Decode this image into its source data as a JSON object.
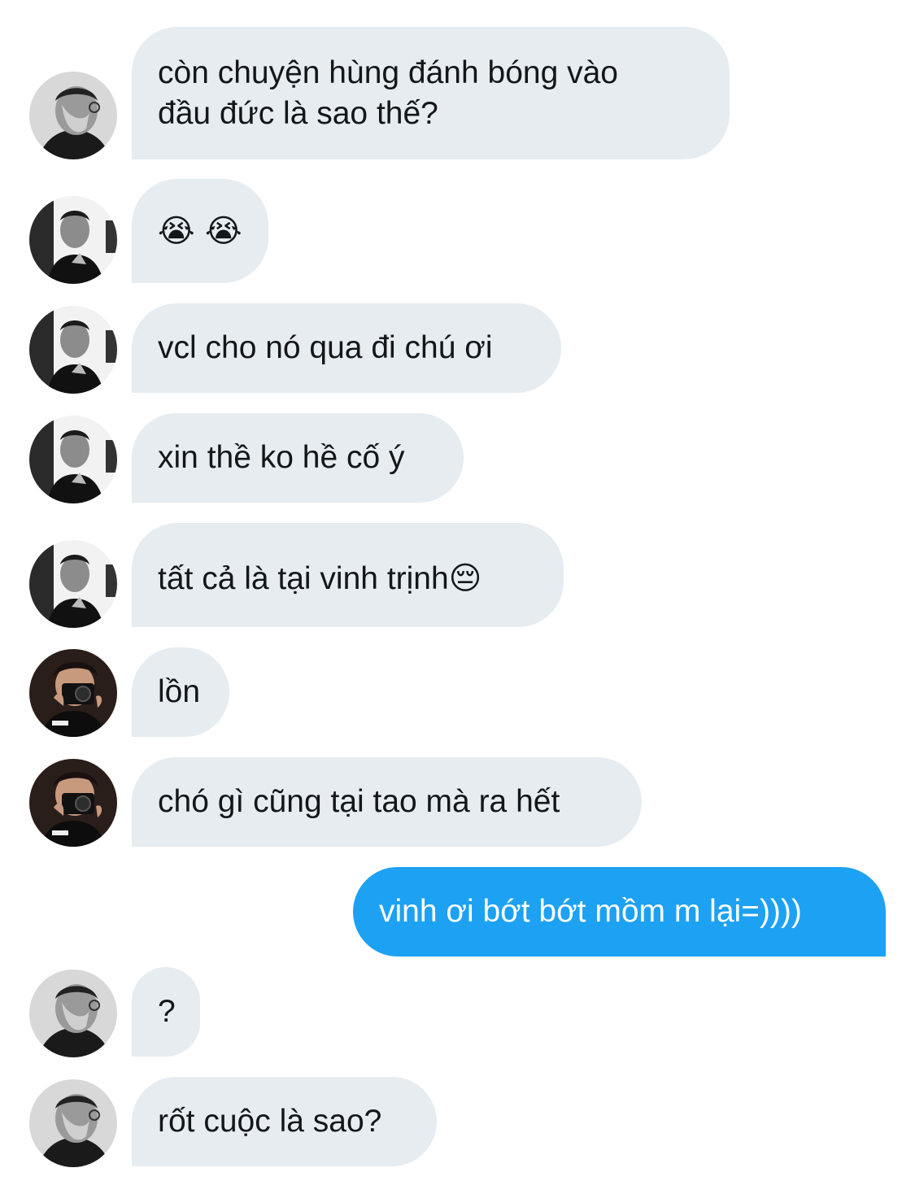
{
  "colors": {
    "incoming_bubble": "#e6ecf0",
    "outgoing_bubble": "#1da1f2",
    "incoming_text": "#14171a",
    "outgoing_text": "#ffffff"
  },
  "messages": [
    {
      "direction": "incoming",
      "avatar": "user-a-avatar",
      "text_line1": "còn chuyện hùng đánh bóng vào",
      "text_line2": "đầu đức là sao thế?"
    },
    {
      "direction": "incoming",
      "avatar": "user-b-avatar",
      "text": "😭 😭"
    },
    {
      "direction": "incoming",
      "avatar": "user-b-avatar",
      "text": "vcl cho nó qua đi chú ơi"
    },
    {
      "direction": "incoming",
      "avatar": "user-b-avatar",
      "text": "xin thề ko hề cố ý"
    },
    {
      "direction": "incoming",
      "avatar": "user-b-avatar",
      "text": "tất cả là tại vinh trịnh😔"
    },
    {
      "direction": "incoming",
      "avatar": "user-c-avatar",
      "text": "lồn"
    },
    {
      "direction": "incoming",
      "avatar": "user-c-avatar",
      "text": "chó gì cũng tại tao mà ra hết"
    },
    {
      "direction": "outgoing",
      "text": "vinh ơi bớt bớt mồm m lại=))))"
    },
    {
      "direction": "incoming",
      "avatar": "user-a-avatar",
      "text": "?"
    },
    {
      "direction": "incoming",
      "avatar": "user-a-avatar",
      "text": "rốt cuộc là sao?"
    }
  ]
}
